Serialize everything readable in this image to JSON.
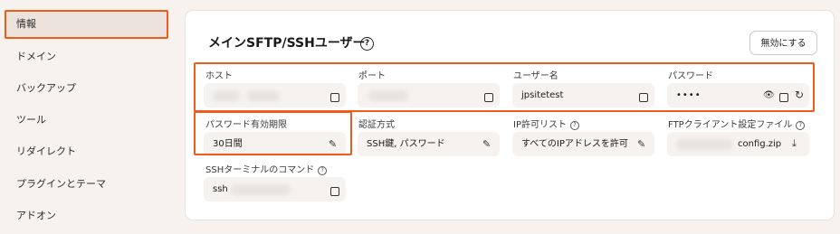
{
  "sidebar": {
    "items": [
      {
        "label": "情報",
        "active": true
      },
      {
        "label": "ドメイン"
      },
      {
        "label": "バックアップ"
      },
      {
        "label": "ツール"
      },
      {
        "label": "リダイレクト"
      },
      {
        "label": "プラグインとテーマ"
      },
      {
        "label": "アドオン"
      }
    ]
  },
  "panel": {
    "title": "メインSFTP/SSHユーザー",
    "disable_button": "無効にする",
    "fields": {
      "host": {
        "label": "ホスト",
        "value": ""
      },
      "port": {
        "label": "ポート",
        "value": ""
      },
      "username": {
        "label": "ユーザー名",
        "value": "jpsitetest"
      },
      "password": {
        "label": "パスワード",
        "value": "••••"
      },
      "password_expiry": {
        "label": "パスワード有効期限",
        "value": "30日間"
      },
      "auth_method": {
        "label": "認証方式",
        "value": "SSH鍵, パスワード"
      },
      "ip_allowlist": {
        "label": "IP許可リスト",
        "value": "すべてのIPアドレスを許可"
      },
      "ftp_config": {
        "label": "FTPクライアント設定ファイル",
        "value": "config.zip"
      },
      "ssh_command": {
        "label": "SSHターミナルのコマンド",
        "value": "ssh"
      }
    }
  },
  "colors": {
    "highlight": "#f25a1a",
    "background": "#f7f2ed",
    "panel": "#ffffff"
  },
  "icons": [
    "help-circle-icon",
    "copy-icon",
    "edit-pencil-icon",
    "eye-icon",
    "refresh-icon",
    "download-icon"
  ]
}
